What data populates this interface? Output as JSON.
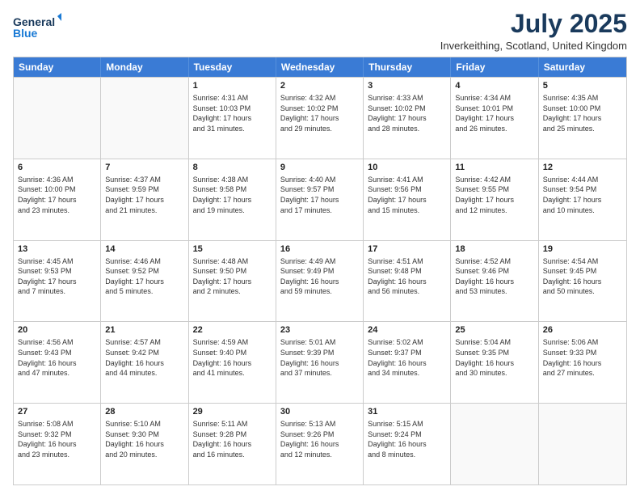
{
  "header": {
    "logo_line1": "General",
    "logo_line2": "Blue",
    "month_title": "July 2025",
    "location": "Inverkeithing, Scotland, United Kingdom"
  },
  "days_of_week": [
    "Sunday",
    "Monday",
    "Tuesday",
    "Wednesday",
    "Thursday",
    "Friday",
    "Saturday"
  ],
  "weeks": [
    [
      {
        "day": "",
        "info": ""
      },
      {
        "day": "",
        "info": ""
      },
      {
        "day": "1",
        "info": "Sunrise: 4:31 AM\nSunset: 10:03 PM\nDaylight: 17 hours\nand 31 minutes."
      },
      {
        "day": "2",
        "info": "Sunrise: 4:32 AM\nSunset: 10:02 PM\nDaylight: 17 hours\nand 29 minutes."
      },
      {
        "day": "3",
        "info": "Sunrise: 4:33 AM\nSunset: 10:02 PM\nDaylight: 17 hours\nand 28 minutes."
      },
      {
        "day": "4",
        "info": "Sunrise: 4:34 AM\nSunset: 10:01 PM\nDaylight: 17 hours\nand 26 minutes."
      },
      {
        "day": "5",
        "info": "Sunrise: 4:35 AM\nSunset: 10:00 PM\nDaylight: 17 hours\nand 25 minutes."
      }
    ],
    [
      {
        "day": "6",
        "info": "Sunrise: 4:36 AM\nSunset: 10:00 PM\nDaylight: 17 hours\nand 23 minutes."
      },
      {
        "day": "7",
        "info": "Sunrise: 4:37 AM\nSunset: 9:59 PM\nDaylight: 17 hours\nand 21 minutes."
      },
      {
        "day": "8",
        "info": "Sunrise: 4:38 AM\nSunset: 9:58 PM\nDaylight: 17 hours\nand 19 minutes."
      },
      {
        "day": "9",
        "info": "Sunrise: 4:40 AM\nSunset: 9:57 PM\nDaylight: 17 hours\nand 17 minutes."
      },
      {
        "day": "10",
        "info": "Sunrise: 4:41 AM\nSunset: 9:56 PM\nDaylight: 17 hours\nand 15 minutes."
      },
      {
        "day": "11",
        "info": "Sunrise: 4:42 AM\nSunset: 9:55 PM\nDaylight: 17 hours\nand 12 minutes."
      },
      {
        "day": "12",
        "info": "Sunrise: 4:44 AM\nSunset: 9:54 PM\nDaylight: 17 hours\nand 10 minutes."
      }
    ],
    [
      {
        "day": "13",
        "info": "Sunrise: 4:45 AM\nSunset: 9:53 PM\nDaylight: 17 hours\nand 7 minutes."
      },
      {
        "day": "14",
        "info": "Sunrise: 4:46 AM\nSunset: 9:52 PM\nDaylight: 17 hours\nand 5 minutes."
      },
      {
        "day": "15",
        "info": "Sunrise: 4:48 AM\nSunset: 9:50 PM\nDaylight: 17 hours\nand 2 minutes."
      },
      {
        "day": "16",
        "info": "Sunrise: 4:49 AM\nSunset: 9:49 PM\nDaylight: 16 hours\nand 59 minutes."
      },
      {
        "day": "17",
        "info": "Sunrise: 4:51 AM\nSunset: 9:48 PM\nDaylight: 16 hours\nand 56 minutes."
      },
      {
        "day": "18",
        "info": "Sunrise: 4:52 AM\nSunset: 9:46 PM\nDaylight: 16 hours\nand 53 minutes."
      },
      {
        "day": "19",
        "info": "Sunrise: 4:54 AM\nSunset: 9:45 PM\nDaylight: 16 hours\nand 50 minutes."
      }
    ],
    [
      {
        "day": "20",
        "info": "Sunrise: 4:56 AM\nSunset: 9:43 PM\nDaylight: 16 hours\nand 47 minutes."
      },
      {
        "day": "21",
        "info": "Sunrise: 4:57 AM\nSunset: 9:42 PM\nDaylight: 16 hours\nand 44 minutes."
      },
      {
        "day": "22",
        "info": "Sunrise: 4:59 AM\nSunset: 9:40 PM\nDaylight: 16 hours\nand 41 minutes."
      },
      {
        "day": "23",
        "info": "Sunrise: 5:01 AM\nSunset: 9:39 PM\nDaylight: 16 hours\nand 37 minutes."
      },
      {
        "day": "24",
        "info": "Sunrise: 5:02 AM\nSunset: 9:37 PM\nDaylight: 16 hours\nand 34 minutes."
      },
      {
        "day": "25",
        "info": "Sunrise: 5:04 AM\nSunset: 9:35 PM\nDaylight: 16 hours\nand 30 minutes."
      },
      {
        "day": "26",
        "info": "Sunrise: 5:06 AM\nSunset: 9:33 PM\nDaylight: 16 hours\nand 27 minutes."
      }
    ],
    [
      {
        "day": "27",
        "info": "Sunrise: 5:08 AM\nSunset: 9:32 PM\nDaylight: 16 hours\nand 23 minutes."
      },
      {
        "day": "28",
        "info": "Sunrise: 5:10 AM\nSunset: 9:30 PM\nDaylight: 16 hours\nand 20 minutes."
      },
      {
        "day": "29",
        "info": "Sunrise: 5:11 AM\nSunset: 9:28 PM\nDaylight: 16 hours\nand 16 minutes."
      },
      {
        "day": "30",
        "info": "Sunrise: 5:13 AM\nSunset: 9:26 PM\nDaylight: 16 hours\nand 12 minutes."
      },
      {
        "day": "31",
        "info": "Sunrise: 5:15 AM\nSunset: 9:24 PM\nDaylight: 16 hours\nand 8 minutes."
      },
      {
        "day": "",
        "info": ""
      },
      {
        "day": "",
        "info": ""
      }
    ]
  ]
}
